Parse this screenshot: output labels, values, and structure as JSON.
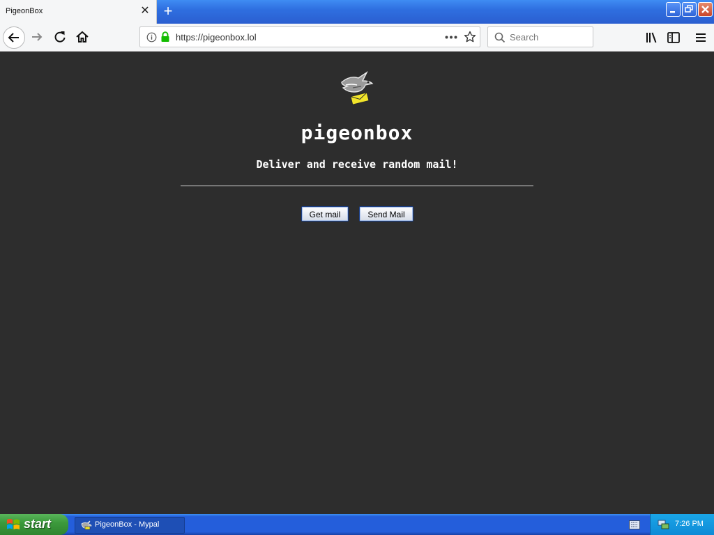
{
  "browser": {
    "tab": {
      "title": "PigeonBox",
      "close_icon": "close-icon"
    },
    "new_tab_icon": "plus-icon",
    "window_controls": [
      "minimize-icon",
      "maximize-icon",
      "close-icon"
    ],
    "url": "https://pigeonbox.lol",
    "search": {
      "placeholder": "Search"
    },
    "accent": "#2f6fe0"
  },
  "page": {
    "title": "pigeonbox",
    "tagline": "Deliver and receive random mail!",
    "buttons": {
      "get_mail": "Get mail",
      "send_mail": "Send Mail"
    },
    "background": "#2d2d2d"
  },
  "taskbar": {
    "start_label": "start",
    "task_item": "PigeonBox - Mypal",
    "clock": "7:26 PM"
  }
}
